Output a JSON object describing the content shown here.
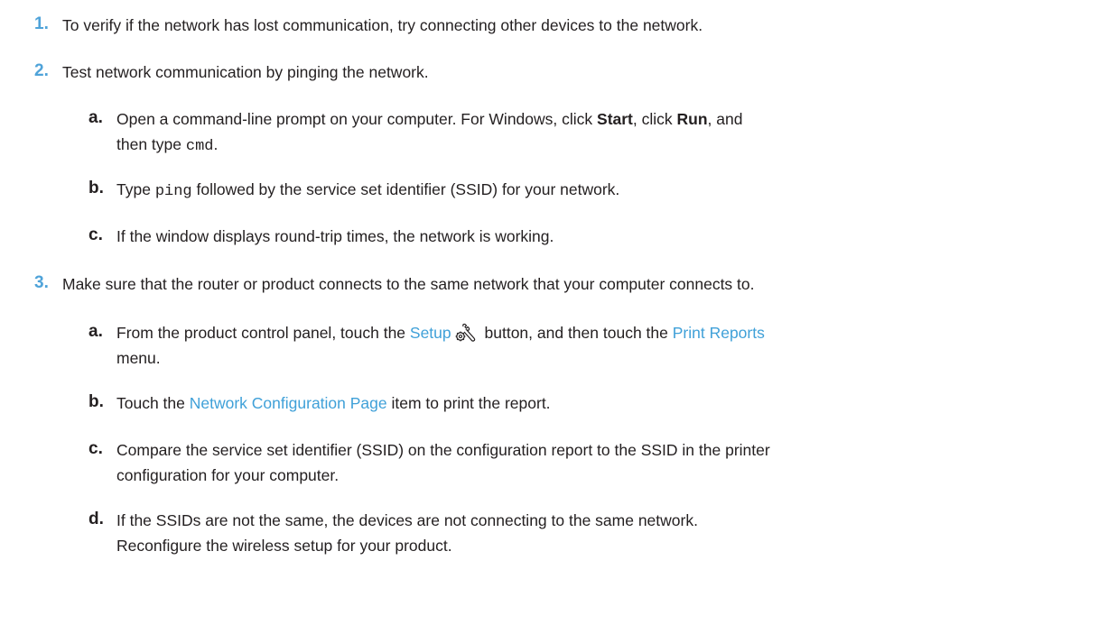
{
  "steps": [
    {
      "number": "1.",
      "text": "To verify if the network has lost communication, try connecting other devices to the network."
    },
    {
      "number": "2.",
      "text": "Test network communication by pinging the network.",
      "substeps": [
        {
          "letter": "a.",
          "line1_pre": "Open a command-line prompt on your computer. For Windows, click ",
          "start": "Start",
          "line1_mid": ", click ",
          "run": "Run",
          "line1_post": ", and",
          "line2_pre": "then type ",
          "cmd": "cmd",
          "line2_post": "."
        },
        {
          "letter": "b.",
          "pre": "Type ",
          "ping": "ping",
          "post": " followed by the service set identifier (SSID) for your network."
        },
        {
          "letter": "c.",
          "text": "If the window displays round-trip times, the network is working."
        }
      ]
    },
    {
      "number": "3.",
      "text": "Make sure that the router or product connects to the same network that your computer connects to.",
      "substeps": [
        {
          "letter": "a.",
          "pre": "From the product control panel, touch the ",
          "setup": "Setup",
          "icon": "setup-wrench-gear-icon",
          "mid": " button, and then touch the ",
          "print_reports": "Print Reports",
          "line2": "menu."
        },
        {
          "letter": "b.",
          "pre": "Touch the ",
          "network_config_page": "Network Configuration Page",
          "post": " item to print the report."
        },
        {
          "letter": "c.",
          "line1": "Compare the service set identifier (SSID) on the configuration report to the SSID in the printer",
          "line2": "configuration for your computer."
        },
        {
          "letter": "d.",
          "line1": "If the SSIDs are not the same, the devices are not connecting to the same network.",
          "line2": "Reconfigure the wireless setup for your product."
        }
      ]
    }
  ],
  "colors": {
    "step_number": "#4fa3d9",
    "ui_term": "#3fa0d8",
    "body_text": "#231f20"
  }
}
